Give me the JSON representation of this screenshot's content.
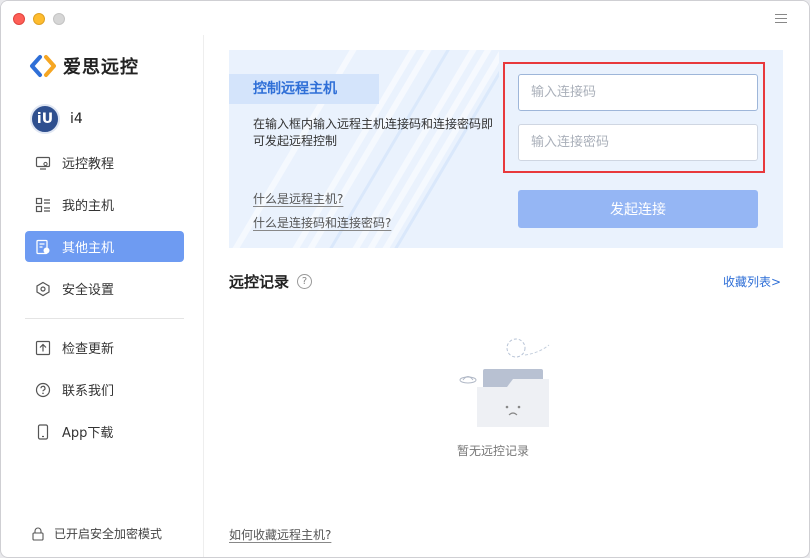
{
  "app": {
    "name": "爱思远控"
  },
  "user": {
    "avatar_text": "iU",
    "name": "i4"
  },
  "nav": [
    {
      "label": "远控教程",
      "icon": "monitor-icon"
    },
    {
      "label": "我的主机",
      "icon": "host-list-icon"
    },
    {
      "label": "其他主机",
      "icon": "other-host-icon",
      "active": true
    },
    {
      "label": "安全设置",
      "icon": "shield-icon"
    }
  ],
  "nav2": [
    {
      "label": "检查更新",
      "icon": "upload-icon"
    },
    {
      "label": "联系我们",
      "icon": "help-circle-icon"
    },
    {
      "label": "App下载",
      "icon": "phone-icon"
    }
  ],
  "secure_mode": {
    "label": "已开启安全加密模式",
    "icon": "lock-icon"
  },
  "banner": {
    "title": "控制远程主机",
    "desc": "在输入框内输入远程主机连接码和连接密码即可发起远程控制",
    "link1": "什么是远程主机?",
    "link2": "什么是连接码和连接密码?",
    "code_placeholder": "输入连接码",
    "pwd_placeholder": "输入连接密码",
    "connect_label": "发起连接"
  },
  "records": {
    "title": "远控记录",
    "help_glyph": "?",
    "fav_link": "收藏列表>",
    "empty_text": "暂无远控记录",
    "bottom_link": "如何收藏远程主机?"
  },
  "colors": {
    "accent": "#6e9bf2",
    "link": "#2f6fd7",
    "highlight": "#e8393c"
  }
}
